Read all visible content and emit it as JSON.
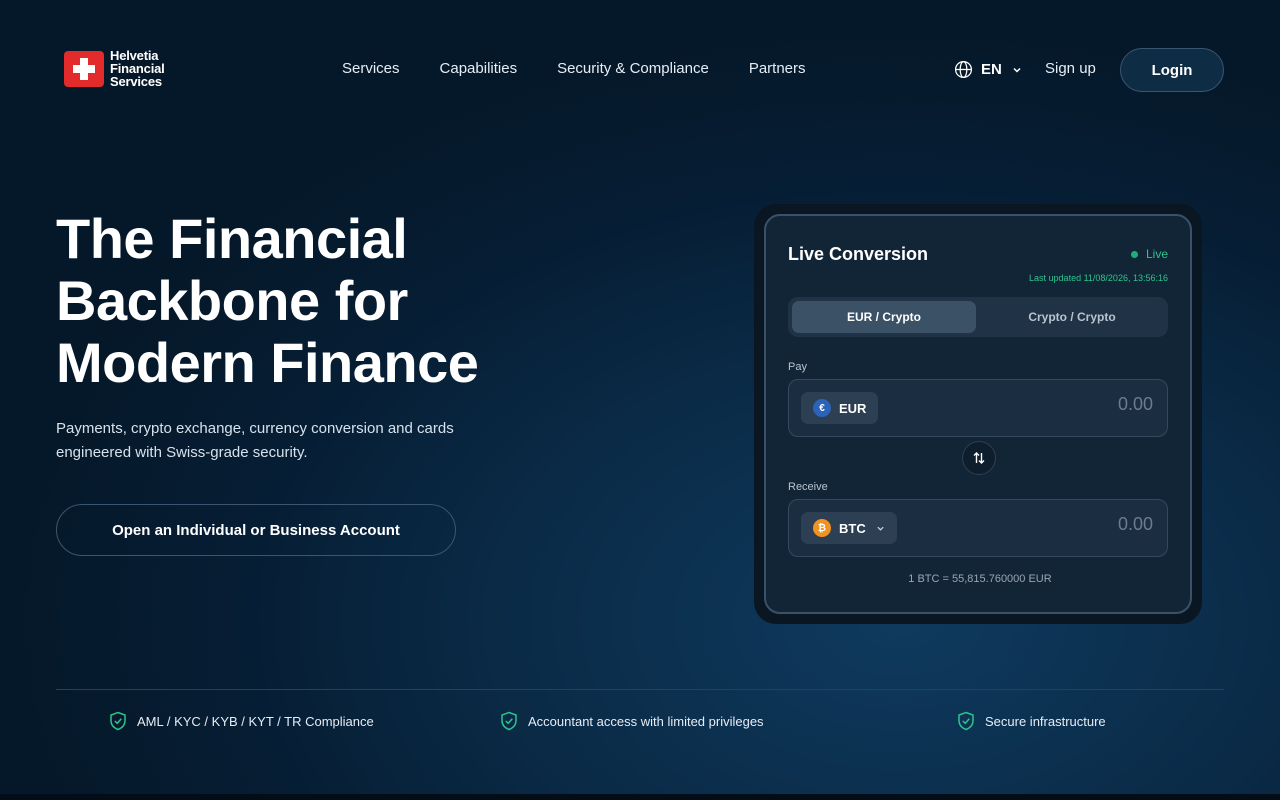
{
  "brand": {
    "line1": "Helvetia",
    "line2": "Financial",
    "line3": "Services",
    "accent_color": "#e32b2b"
  },
  "nav": {
    "items": [
      "Services",
      "Capabilities",
      "Security & Compliance",
      "Partners"
    ]
  },
  "header": {
    "language": "EN",
    "signup_label": "Sign up",
    "login_label": "Login"
  },
  "hero": {
    "title_line1": "The Financial",
    "title_line2": "Backbone for",
    "title_line3": "Modern Finance",
    "subtitle": "Payments, crypto exchange, currency conversion and cards engineered with Swiss-grade security.",
    "cta_label": "Open an Individual or Business Account"
  },
  "converter": {
    "title": "Live Conversion",
    "status": "Live",
    "status_color": "#2ec48e",
    "last_updated": "Last updated 11/08/2026, 13:56:16",
    "tabs": [
      {
        "label": "EUR / Crypto",
        "active": true
      },
      {
        "label": "Crypto / Crypto",
        "active": false
      }
    ],
    "pay": {
      "label": "Pay",
      "currency": "EUR",
      "currency_icon": "€",
      "placeholder": "0.00"
    },
    "receive": {
      "label": "Receive",
      "currency": "BTC",
      "currency_icon": "₿",
      "placeholder": "0.00"
    },
    "rate": "1 BTC = 55,815.760000 EUR"
  },
  "features": [
    "AML / KYC / KYB / KYT / TR Compliance",
    "Accountant access with limited privileges",
    "Secure infrastructure"
  ],
  "icons": {
    "globe": "globe-icon",
    "swap": "swap-arrows-icon",
    "shield": "shield-check-icon"
  }
}
